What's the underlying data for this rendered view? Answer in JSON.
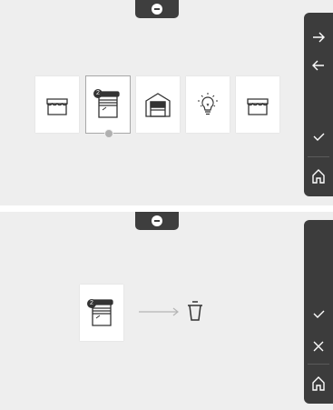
{
  "top_panel": {
    "devices": [
      {
        "icon": "awning-icon",
        "badge": ""
      },
      {
        "icon": "roller-shutter-icon",
        "badge": "2",
        "selected": true
      },
      {
        "icon": "garage-door-icon",
        "badge": ""
      },
      {
        "icon": "light-bulb-icon",
        "badge": ""
      },
      {
        "icon": "awning-icon",
        "badge": ""
      }
    ],
    "sidebar": [
      "arrow-right-icon",
      "arrow-left-icon",
      "check-icon",
      "home-icon"
    ]
  },
  "bottom_panel": {
    "source_device": {
      "icon": "roller-shutter-icon",
      "badge": "2"
    },
    "action": "arrow-right-icon",
    "target": "trash-icon",
    "sidebar": [
      "check-icon",
      "close-icon",
      "home-icon"
    ]
  },
  "colors": {
    "background": "#eeeeee",
    "dark": "#3c3c3c",
    "icon": "#333333"
  }
}
